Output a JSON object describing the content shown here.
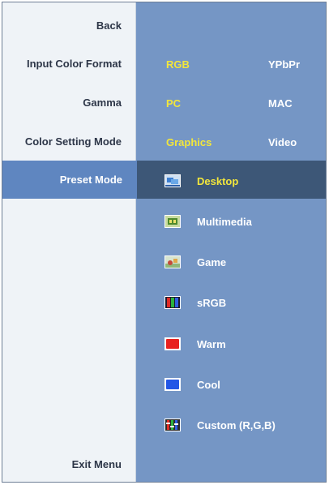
{
  "left_menu": {
    "back": "Back",
    "input_color_format": "Input Color Format",
    "gamma": "Gamma",
    "color_setting_mode": "Color Setting Mode",
    "preset_mode": "Preset Mode",
    "exit_menu": "Exit Menu"
  },
  "input_color_format": {
    "options": [
      "RGB",
      "YPbPr"
    ],
    "selected": "RGB"
  },
  "gamma": {
    "options": [
      "PC",
      "MAC"
    ],
    "selected": "PC"
  },
  "color_setting_mode": {
    "options": [
      "Graphics",
      "Video"
    ],
    "selected": "Graphics"
  },
  "preset_mode": {
    "selected": "Desktop",
    "items": [
      {
        "label": "Desktop",
        "icon": "desktop-icon"
      },
      {
        "label": "Multimedia",
        "icon": "multimedia-icon"
      },
      {
        "label": "Game",
        "icon": "game-icon"
      },
      {
        "label": "sRGB",
        "icon": "srgb-icon"
      },
      {
        "label": "Warm",
        "icon": "warm-icon"
      },
      {
        "label": "Cool",
        "icon": "cool-icon"
      },
      {
        "label": "Custom (R,G,B)",
        "icon": "custom-rgb-icon"
      }
    ]
  },
  "colors": {
    "left_panel": "#eff3f7",
    "right_panel": "#7596c5",
    "selected_row": "#5f86c0",
    "selected_bar": "#3d5777",
    "active_text": "#f2e63c",
    "warm": "#e8211e",
    "cool": "#2256e6"
  }
}
